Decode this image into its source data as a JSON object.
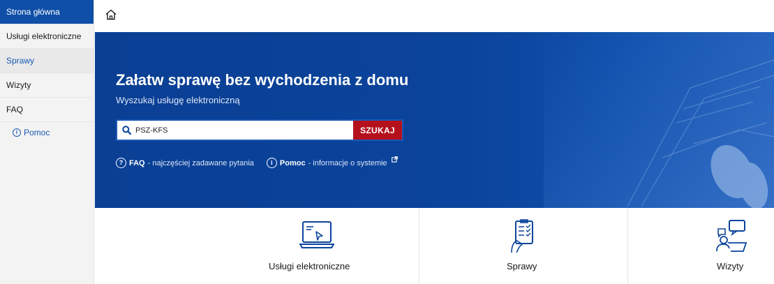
{
  "sidebar": {
    "items": [
      {
        "label": "Strona główna"
      },
      {
        "label": "Usługi elektroniczne"
      },
      {
        "label": "Sprawy"
      },
      {
        "label": "Wizyty"
      },
      {
        "label": "FAQ"
      }
    ],
    "help_label": "Pomoc"
  },
  "topbar": {
    "home_icon": "home-icon"
  },
  "hero": {
    "title": "Załatw sprawę bez wychodzenia z domu",
    "subtitle": "Wyszukaj usługę elektroniczną",
    "search": {
      "value": "PSZ-KFS",
      "button_label": "SZUKAJ"
    },
    "links": [
      {
        "bold": "FAQ",
        "text": " - najczęściej zadawane pytania",
        "icon": "question-circle-icon"
      },
      {
        "bold": "Pomoc",
        "text": " - informacje o systemie",
        "icon": "info-circle-icon"
      }
    ]
  },
  "cards": [
    {
      "label": "Usługi elektroniczne",
      "icon": "laptop-icon"
    },
    {
      "label": "Sprawy",
      "icon": "document-checklist-icon"
    },
    {
      "label": "Wizyty",
      "icon": "meeting-icon"
    }
  ],
  "colors": {
    "primary": "#0b449c",
    "sidebar_active": "#0f4fa8",
    "search_button": "#b4111d",
    "link": "#1a58b5"
  }
}
